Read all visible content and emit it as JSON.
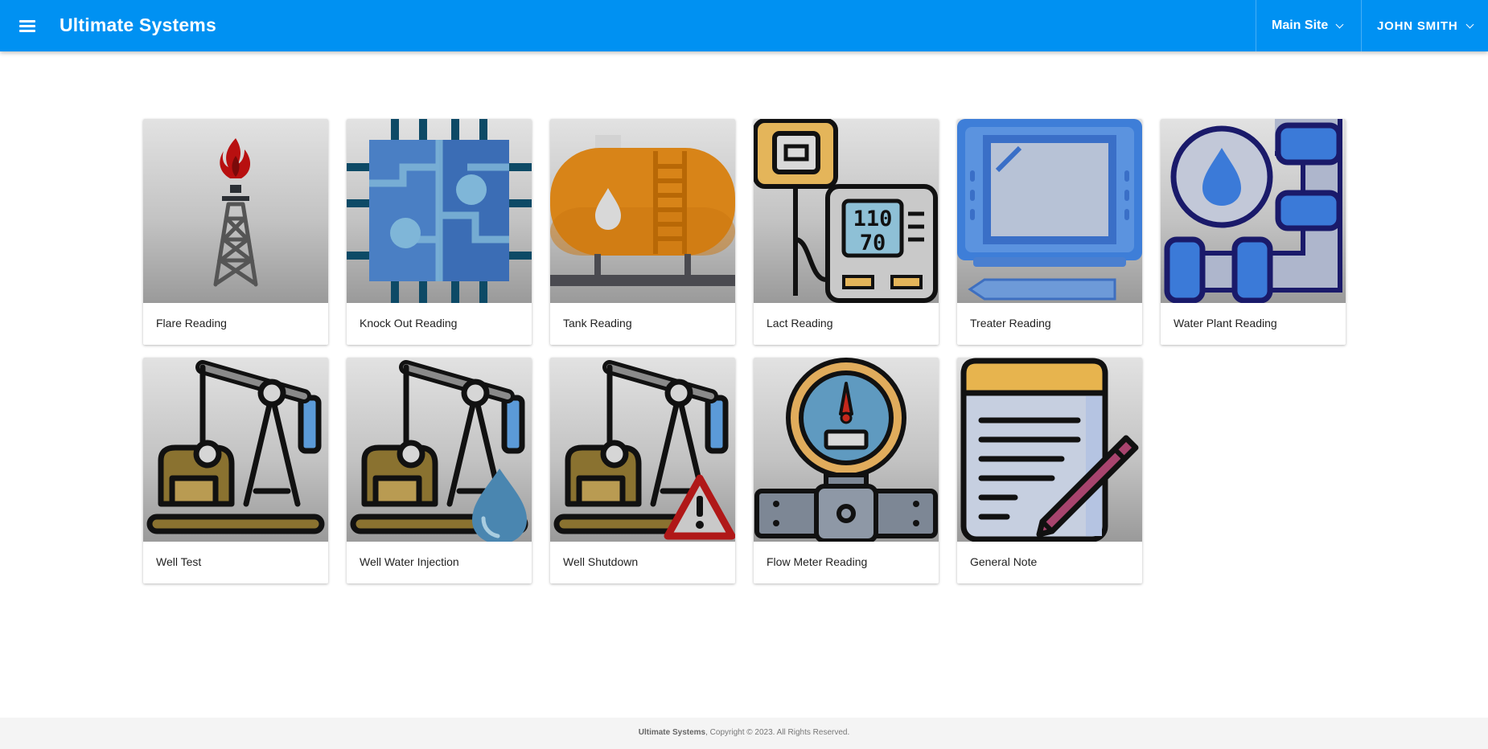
{
  "header": {
    "app_title": "Ultimate Systems",
    "site_label": "Main Site",
    "user_label": "JOHN SMITH",
    "accent_color": "#0091f2"
  },
  "cards": [
    {
      "label": "Flare Reading",
      "icon": "flare-stack-icon"
    },
    {
      "label": "Knock Out Reading",
      "icon": "knockout-circuit-icon"
    },
    {
      "label": "Tank Reading",
      "icon": "oil-tank-icon"
    },
    {
      "label": "Lact Reading",
      "icon": "lact-meter-icon"
    },
    {
      "label": "Treater Reading",
      "icon": "treater-monitor-icon"
    },
    {
      "label": "Water Plant Reading",
      "icon": "water-pipe-icon"
    },
    {
      "label": "Well Test",
      "icon": "pumpjack-icon"
    },
    {
      "label": "Well Water Injection",
      "icon": "pumpjack-water-icon"
    },
    {
      "label": "Well Shutdown",
      "icon": "pumpjack-warning-icon"
    },
    {
      "label": "Flow Meter Reading",
      "icon": "flow-meter-icon"
    },
    {
      "label": "General Note",
      "icon": "notepad-pencil-icon"
    }
  ],
  "lact_display": {
    "top": "110",
    "bottom": "70"
  },
  "footer": {
    "brand": "Ultimate Systems",
    "copyright": ", Copyright © 2023. All Rights Reserved."
  }
}
